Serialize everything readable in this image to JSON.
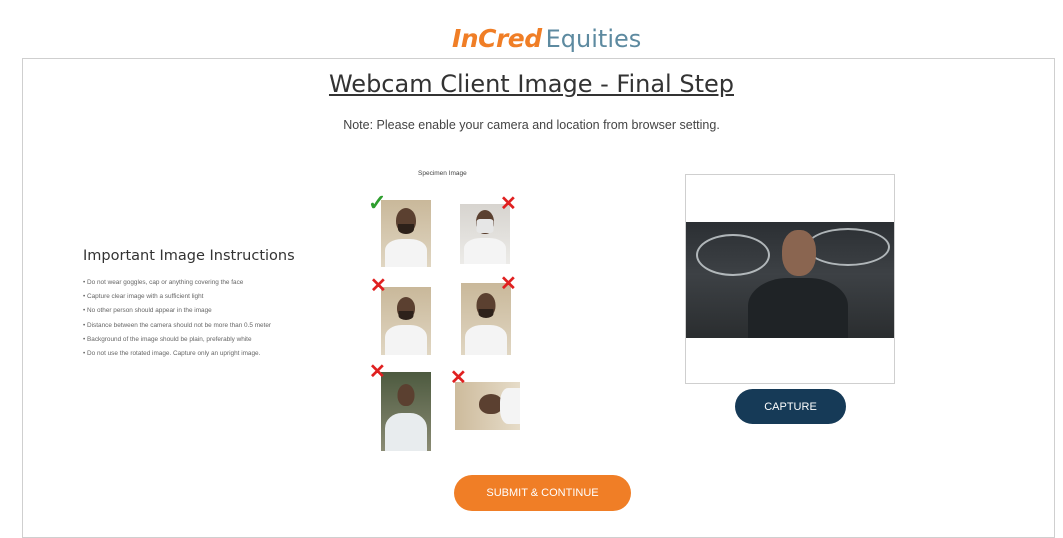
{
  "brand": {
    "name_part1": "InCred",
    "name_part2": "Equities"
  },
  "page": {
    "title": "Webcam Client Image - Final Step",
    "note": "Note: Please enable your camera and location from browser setting."
  },
  "instructions": {
    "title": "Important Image Instructions",
    "items": [
      "• Do not wear goggles, cap or anything covering the face",
      "• Capture clear image with a sufficient light",
      "• No other person should appear in the image",
      "• Distance between the camera should not be more than 0.5 meter",
      "• Background of the image should be plain, preferably white",
      "• Do not use the rotated image. Capture only an upright image."
    ]
  },
  "specimen": {
    "label": "Specimen Image",
    "marks": {
      "ok": "✓",
      "bad": "✕"
    }
  },
  "buttons": {
    "capture": "CAPTURE",
    "submit": "SUBMIT & CONTINUE"
  },
  "colors": {
    "orange": "#f07e26",
    "navy": "#163a57",
    "teal": "#5d8aa0",
    "ok": "#2e9e2e",
    "bad": "#e02020"
  }
}
